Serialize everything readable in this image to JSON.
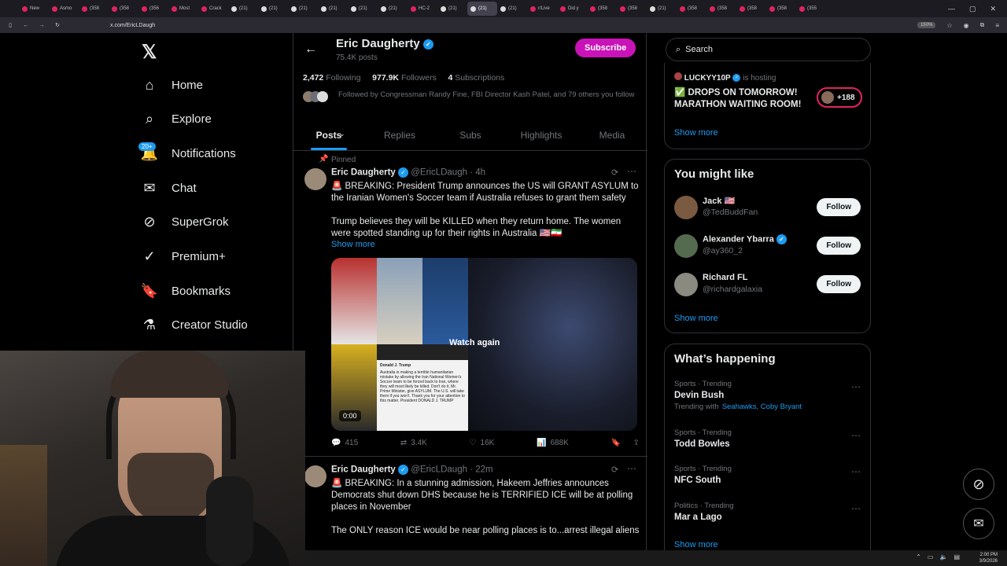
{
  "browser": {
    "tabs": [
      "New",
      "Asmo",
      "(358",
      "(358",
      "(356",
      "Most",
      "Crack",
      "(21)",
      "(21)",
      "(21)",
      "(21)",
      "(21)",
      "(21)",
      "HC-2",
      "(21)",
      "(21)",
      "(21)",
      "r/Live",
      "Did y",
      "(358",
      "(358",
      "(21)",
      "(358",
      "(358",
      "(358",
      "(358",
      "(355"
    ],
    "active_tab_index": 15,
    "url": "x.com/EricLDaugh",
    "zoom": "150%"
  },
  "nav": {
    "items": [
      {
        "label": "Home",
        "icon": "home-icon"
      },
      {
        "label": "Explore",
        "icon": "search-icon"
      },
      {
        "label": "Notifications",
        "icon": "bell-icon"
      },
      {
        "label": "Chat",
        "icon": "mail-icon"
      },
      {
        "label": "SuperGrok",
        "icon": "grok-icon"
      },
      {
        "label": "Premium+",
        "icon": "verified-icon"
      },
      {
        "label": "Bookmarks",
        "icon": "bookmark-icon"
      },
      {
        "label": "Creator Studio",
        "icon": "flask-icon"
      }
    ],
    "notif_badge": "20+"
  },
  "profile": {
    "name": "Eric Daugherty",
    "posts": "75.4K posts",
    "subscribe": "Subscribe",
    "following_count": "2,472",
    "following_label": "Following",
    "followers_count": "977.9K",
    "followers_label": "Followers",
    "subs_count": "4",
    "subs_label": "Subscriptions",
    "followed_by": "Followed by Congressman Randy Fine, FBI Director Kash Patel, and 79 others you follow",
    "tabs": [
      "Posts",
      "Replies",
      "Subs",
      "Highlights",
      "Media"
    ]
  },
  "tweet1": {
    "pinned": "Pinned",
    "name": "Eric Daugherty",
    "handle": "@EricLDaugh",
    "time": "· 4h",
    "text1": "🚨 BREAKING: President Trump announces the US will GRANT ASYLUM to the Iranian Women's Soccer team if Australia refuses to grant them safety",
    "text2": "Trump believes they will be KILLED when they return home. The women were spotted standing up for their rights in Australia 🇺🇸🇮🇷",
    "show_more": "Show more",
    "watch_again": "Watch again",
    "duration": "0:00",
    "replies": "415",
    "reposts": "3.4K",
    "likes": "16K",
    "views": "688K",
    "media_post_name": "Donald J. Trump",
    "media_post_text": "Australia is making a terrible humanitarian mistake by allowing the Iran National Women's Soccer team to be forced back to Iran, where they will most likely be killed. Don't do it, Mr. Prime Minister, give ASYLUM. The U.S. will take them if you won't. Thank you for your attention to this matter. President DONALD J. TRUMP"
  },
  "tweet2": {
    "name": "Eric Daugherty",
    "handle": "@EricLDaugh",
    "time": "· 22m",
    "text1": "🚨 BREAKING: In a stunning admission, Hakeem Jeffries announces Democrats shut down DHS because he is TERRIFIED ICE will be at polling places in November",
    "text2": "The ONLY reason ICE would be near polling places is to...arrest illegal aliens"
  },
  "right": {
    "search_placeholder": "Search",
    "host_name": "LUCKYY10P",
    "host_suffix": "is hosting",
    "host_text": "✅ DROPS ON TOMORROW! MARATHON WAITING ROOM!",
    "host_count": "+188",
    "show_more": "Show more",
    "might_like_title": "You might like",
    "suggestions": [
      {
        "name": "Jack 🇺🇸",
        "handle": "@TedBuddFan",
        "button": "Follow"
      },
      {
        "name": "Alexander Ybarra",
        "handle": "@ay360_2",
        "button": "Follow"
      },
      {
        "name": "Richard FL",
        "handle": "@richardgalaxia",
        "button": "Follow"
      }
    ],
    "happening_title": "What’s happening",
    "trends": [
      {
        "category": "Sports · Trending",
        "name": "Devin Bush",
        "with_label": "Trending with",
        "with": "Seahawks, Coby Bryant"
      },
      {
        "category": "Sports · Trending",
        "name": "Todd Bowles"
      },
      {
        "category": "Sports · Trending",
        "name": "NFC South"
      },
      {
        "category": "Politics · Trending",
        "name": "Mar a Lago"
      }
    ]
  },
  "taskbar": {
    "time": "2:00 PM",
    "date": "3/9/2026"
  },
  "colors": {
    "accent": "#1d9bf0",
    "subscribe": "#c913b8",
    "bg": "#000000"
  }
}
